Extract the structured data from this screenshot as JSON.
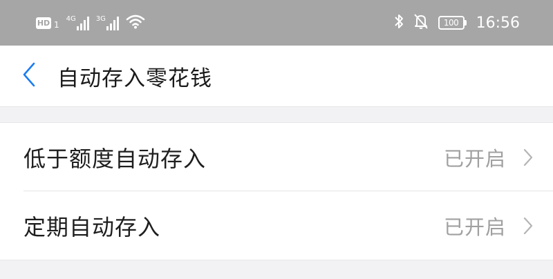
{
  "status_bar": {
    "hd_label": "HD",
    "sim_digit": "1",
    "network_1": "4G",
    "network_2": "3G",
    "battery_label": "100",
    "time": "16:56",
    "icons": [
      "hd-badge",
      "signal-4g-icon",
      "signal-3g-icon",
      "wifi-icon",
      "bluetooth-icon",
      "mute-icon",
      "battery-icon"
    ]
  },
  "nav": {
    "title": "自动存入零花钱",
    "back_icon": "chevron-left-icon",
    "accent_color": "#1a7cf2"
  },
  "settings": {
    "items": [
      {
        "label": "低于额度自动存入",
        "status": "已开启",
        "icon": "chevron-right-icon"
      },
      {
        "label": "定期自动存入",
        "status": "已开启",
        "icon": "chevron-right-icon"
      }
    ]
  }
}
